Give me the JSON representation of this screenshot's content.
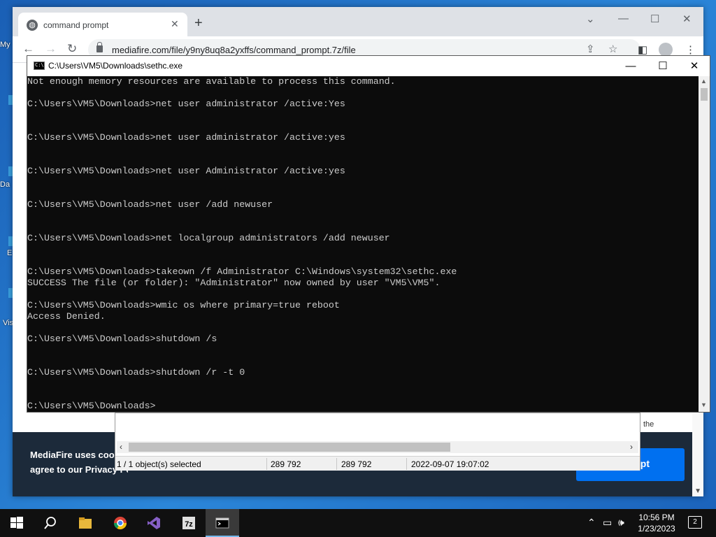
{
  "desktop": {
    "icons": [
      {
        "label": "My",
        "glyph": "folder-icon"
      },
      {
        "label": "Da",
        "glyph": "app-icon"
      },
      {
        "label": "E",
        "glyph": "app-icon"
      },
      {
        "label": "Vis",
        "glyph": "app-icon"
      }
    ]
  },
  "browser": {
    "tab_title": "command prompt",
    "tab_favicon": "globe-icon",
    "new_tab": "+",
    "url": "mediafire.com/file/y9ny8uq8a2yxffs/command_prompt.7z/file",
    "window_controls": {
      "dropdown": "⌄",
      "minimize": "—",
      "maximize": "☐",
      "close": "✕"
    },
    "nav": {
      "back": "←",
      "forward": "→",
      "reload": "↻"
    },
    "cookie": {
      "line1": "MediaFire uses cook",
      "line2": "agree to our Privacy Policy.",
      "accept_label": "pt"
    },
    "page_text_the": "the"
  },
  "zip": {
    "status": [
      "1 / 1 object(s) selected",
      "289 792",
      "289 792",
      "2022-09-07 19:07:02"
    ]
  },
  "cmd": {
    "title": "C:\\Users\\VM5\\Downloads\\sethc.exe",
    "lines": [
      "Not enough memory resources are available to process this command.",
      "",
      "C:\\Users\\VM5\\Downloads>net user administrator /active:Yes",
      "",
      "",
      "C:\\Users\\VM5\\Downloads>net user administrator /active:yes",
      "",
      "",
      "C:\\Users\\VM5\\Downloads>net user Administrator /active:yes",
      "",
      "",
      "C:\\Users\\VM5\\Downloads>net user /add newuser",
      "",
      "",
      "C:\\Users\\VM5\\Downloads>net localgroup administrators /add newuser",
      "",
      "",
      "C:\\Users\\VM5\\Downloads>takeown /f Administrator C:\\Windows\\system32\\sethc.exe",
      "SUCCESS The file (or folder): \"Administrator\" now owned by user \"VM5\\VM5\".",
      "",
      "C:\\Users\\VM5\\Downloads>wmic os where primary=true reboot",
      "Access Denied.",
      "",
      "C:\\Users\\VM5\\Downloads>shutdown /s",
      "",
      "",
      "C:\\Users\\VM5\\Downloads>shutdown /r -t 0",
      "",
      "",
      "C:\\Users\\VM5\\Downloads>"
    ]
  },
  "taskbar": {
    "apps": [
      "windows-start-icon",
      "search-icon",
      "file-explorer-icon",
      "chrome-icon",
      "visual-studio-icon",
      "7zip-icon",
      "command-prompt-icon"
    ],
    "time": "10:56 PM",
    "date": "1/23/2023",
    "notification_count": "2"
  }
}
